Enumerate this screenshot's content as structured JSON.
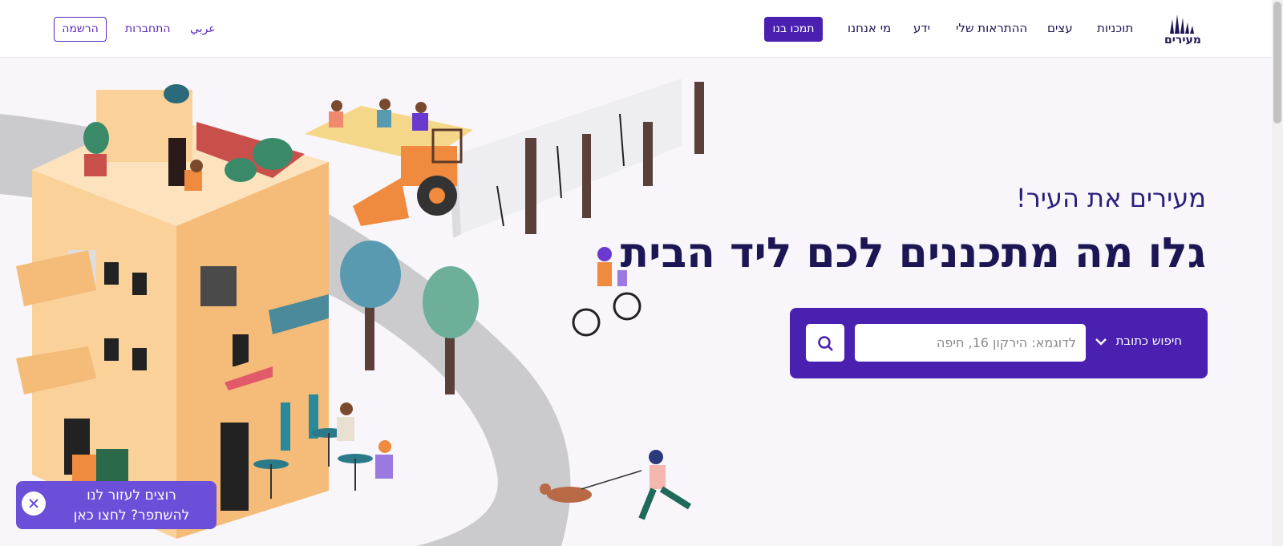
{
  "logo": {
    "text": "מעירים",
    "icon": "city-skyline-icon"
  },
  "nav": {
    "items": [
      {
        "label": "תוכניות"
      },
      {
        "label": "עצים"
      },
      {
        "label": "ההתראות שלי"
      },
      {
        "label": "ידע"
      },
      {
        "label": "מי אנחנו"
      }
    ],
    "support_label": "תמכו בנו",
    "arabic_label": "عربي",
    "login_label": "התחברות",
    "register_label": "הרשמה"
  },
  "hero": {
    "subtitle": "מעירים את העיר!",
    "title": "גלו מה מתכננים לכם ליד הבית"
  },
  "search": {
    "type_label": "חיפוש כתובת",
    "placeholder": "לדוגמא: הירקון 16, חיפה",
    "value": ""
  },
  "help": {
    "line1": "רוצים לעזור לנו",
    "line2": "להשתפר? לחצו כאן"
  },
  "colors": {
    "brand": "#4a20b0",
    "title": "#1d1654",
    "popup": "#6b4fd8"
  }
}
